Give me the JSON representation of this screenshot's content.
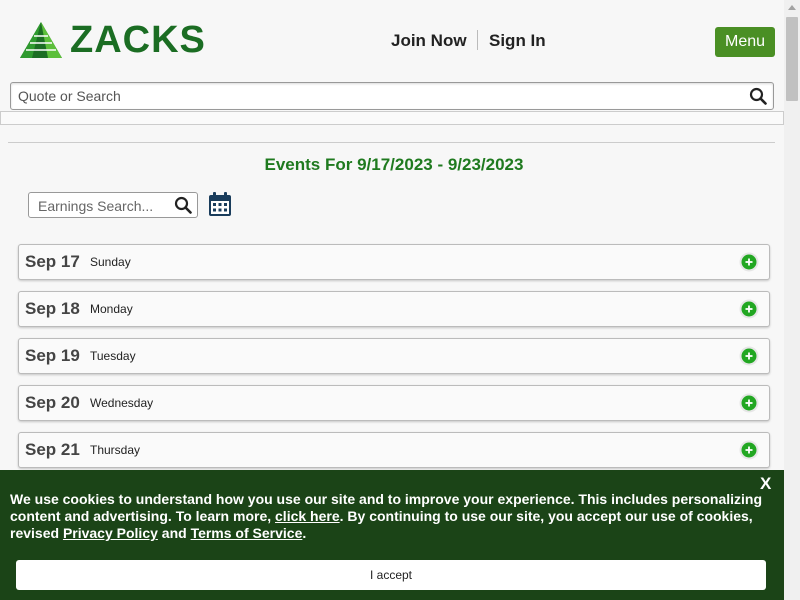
{
  "header": {
    "logo_text": "ZACKS",
    "join_now": "Join Now",
    "sign_in": "Sign In",
    "menu_label": "Menu"
  },
  "search": {
    "placeholder": "Quote or Search"
  },
  "events": {
    "title": "Events For 9/17/2023 - 9/23/2023",
    "earnings_search_placeholder": "Earnings Search...",
    "days": [
      {
        "date": "Sep 17",
        "weekday": "Sunday"
      },
      {
        "date": "Sep 18",
        "weekday": "Monday"
      },
      {
        "date": "Sep 19",
        "weekday": "Tuesday"
      },
      {
        "date": "Sep 20",
        "weekday": "Wednesday"
      },
      {
        "date": "Sep 21",
        "weekday": "Thursday"
      }
    ]
  },
  "cookie_banner": {
    "close_label": "X",
    "text_part1": "We use cookies to understand how you use our site and to improve your experience. This includes personalizing content and advertising. To learn more, ",
    "link_click_here": "click here",
    "text_part2": ". By continuing to use our site, you accept our use of cookies, revised ",
    "link_privacy": "Privacy Policy",
    "text_part3": " and ",
    "link_terms": "Terms of Service",
    "text_part4": ".",
    "accept_label": "I accept"
  },
  "colors": {
    "brand_green": "#1b6d23",
    "menu_green": "#4a8f24",
    "title_green": "#1f7a1f",
    "banner_bg": "#1b4417",
    "expand_green": "#22a722"
  }
}
